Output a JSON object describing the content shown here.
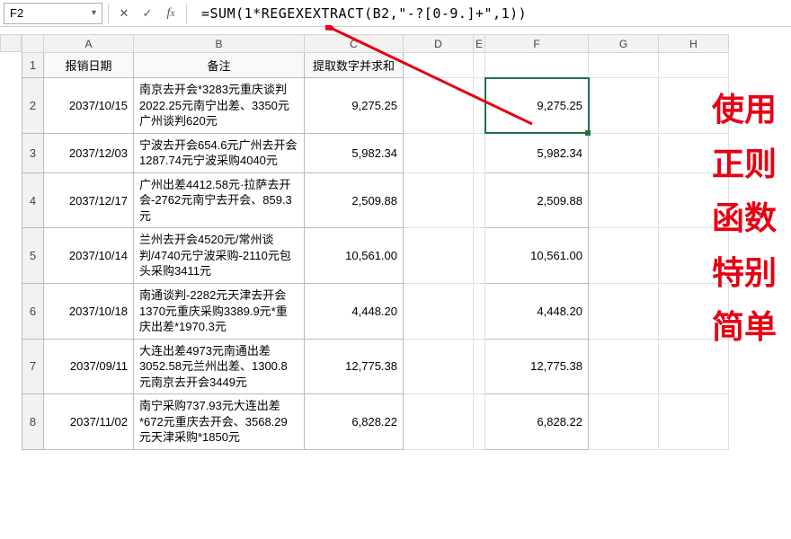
{
  "formula_bar": {
    "name_box": "F2",
    "formula": "=SUM(1*REGEXEXTRACT(B2,\"-?[0-9.]+\",1))"
  },
  "columns": [
    "A",
    "B",
    "C",
    "D",
    "E",
    "F",
    "G",
    "H"
  ],
  "headers": {
    "A": "报销日期",
    "B": "备注",
    "C": "提取数字并求和"
  },
  "rows": [
    {
      "rn": "2",
      "date": "2037/10/15",
      "note": "南京去开会*3283元重庆谈判2022.25元南宁出差、3350元广州谈判620元",
      "c": "9,275.25",
      "f": "9,275.25"
    },
    {
      "rn": "3",
      "date": "2037/12/03",
      "note": "宁波去开会654.6元广州去开会1287.74元宁波采购4040元",
      "c": "5,982.34",
      "f": "5,982.34"
    },
    {
      "rn": "4",
      "date": "2037/12/17",
      "note": "广州出差4412.58元·拉萨去开会-2762元南宁去开会、859.3元",
      "c": "2,509.88",
      "f": "2,509.88"
    },
    {
      "rn": "5",
      "date": "2037/10/14",
      "note": "兰州去开会4520元/常州谈判/4740元宁波采购-2110元包头采购3411元",
      "c": "10,561.00",
      "f": "10,561.00"
    },
    {
      "rn": "6",
      "date": "2037/10/18",
      "note": "南通谈判-2282元天津去开会1370元重庆采购3389.9元*重庆出差*1970.3元",
      "c": "4,448.20",
      "f": "4,448.20"
    },
    {
      "rn": "7",
      "date": "2037/09/11",
      "note": "大连出差4973元南通出差3052.58元兰州出差、1300.8元南京去开会3449元",
      "c": "12,775.38",
      "f": "12,775.38"
    },
    {
      "rn": "8",
      "date": "2037/11/02",
      "note": "南宁采购737.93元大连出差*672元重庆去开会、3568.29元天津采购*1850元",
      "c": "6,828.22",
      "f": "6,828.22"
    }
  ],
  "callout_lines": [
    "使用",
    "正则",
    "函数",
    "特别",
    "简单"
  ]
}
